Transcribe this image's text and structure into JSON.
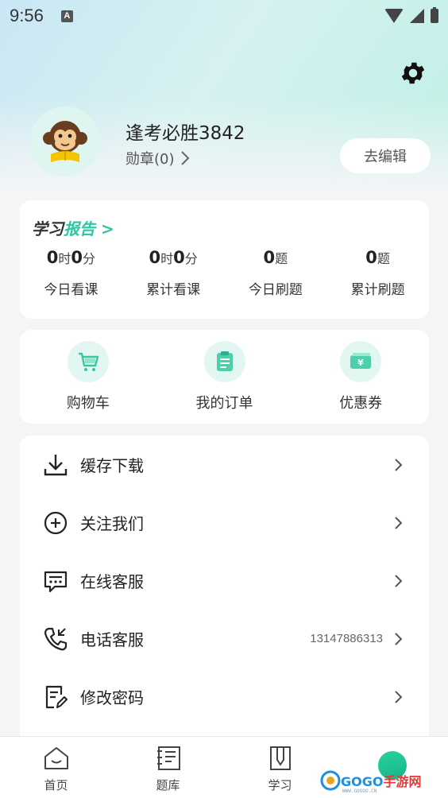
{
  "status_bar": {
    "time": "9:56",
    "notification": "A"
  },
  "profile": {
    "username": "逢考必胜3842",
    "medals": "勋章(0)",
    "edit_label": "去编辑"
  },
  "report": {
    "title_part1": "学习",
    "title_part2": "报告 >",
    "stats": [
      {
        "value_parts": [
          "0",
          "时",
          "0",
          "分"
        ],
        "label": "今日看课"
      },
      {
        "value_parts": [
          "0",
          "时",
          "0",
          "分"
        ],
        "label": "累计看课"
      },
      {
        "value_parts": [
          "0",
          "题"
        ],
        "label": "今日刷题"
      },
      {
        "value_parts": [
          "0",
          "题"
        ],
        "label": "累计刷题"
      }
    ]
  },
  "shortcuts": [
    {
      "label": "购物车",
      "icon": "cart-icon"
    },
    {
      "label": "我的订单",
      "icon": "order-icon"
    },
    {
      "label": "优惠券",
      "icon": "coupon-icon"
    }
  ],
  "menu": [
    {
      "label": "缓存下载",
      "icon": "download-icon"
    },
    {
      "label": "关注我们",
      "icon": "plus-circle-icon"
    },
    {
      "label": "在线客服",
      "icon": "chat-icon"
    },
    {
      "label": "电话客服",
      "icon": "phone-icon",
      "extra": "13147886313"
    },
    {
      "label": "修改密码",
      "icon": "edit-doc-icon"
    }
  ],
  "nav": [
    {
      "label": "首页",
      "icon": "home-icon"
    },
    {
      "label": "题库",
      "icon": "book-icon"
    },
    {
      "label": "学习",
      "icon": "study-icon"
    },
    {
      "label": "",
      "icon": "profile-dot"
    }
  ],
  "watermark": {
    "text_blue": "GOGO",
    "text_red": "手游网",
    "sub": "WWW.GOGOO.CN"
  },
  "colors": {
    "accent": "#2cc7a3",
    "icon_bg": "#e2f7f1"
  }
}
